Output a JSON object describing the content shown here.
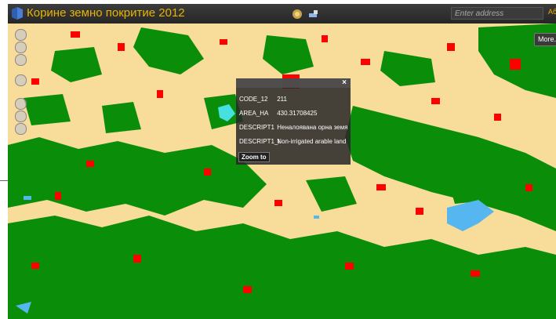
{
  "app": {
    "title": "Корине земно покритие 2012"
  },
  "search": {
    "placeholder": "Enter address",
    "button_label": "Аб"
  },
  "map": {
    "more_label": "More...",
    "colors": {
      "background": "#f8dc9a",
      "forest": "#0a8e0a",
      "urban": "#ff0000",
      "water": "#56b7f0",
      "wetland": "#46e0e0"
    }
  },
  "popup": {
    "fields": [
      {
        "key": "CODE_12",
        "value": "211"
      },
      {
        "key": "AREA_HA",
        "value": "430.31708425"
      },
      {
        "key": "DESCRIPT1",
        "value": "Неналоявана орна земя"
      },
      {
        "key": "DESCRIPT1_t",
        "value": "Non-irrigated arable land"
      }
    ],
    "close_label": "×",
    "zoom_label": "Zoom to"
  },
  "icons": [
    "logo-icon",
    "globe-icon",
    "tools-icon",
    "close-icon",
    "pan-icon",
    "zoom-in-icon",
    "zoom-out-icon"
  ]
}
